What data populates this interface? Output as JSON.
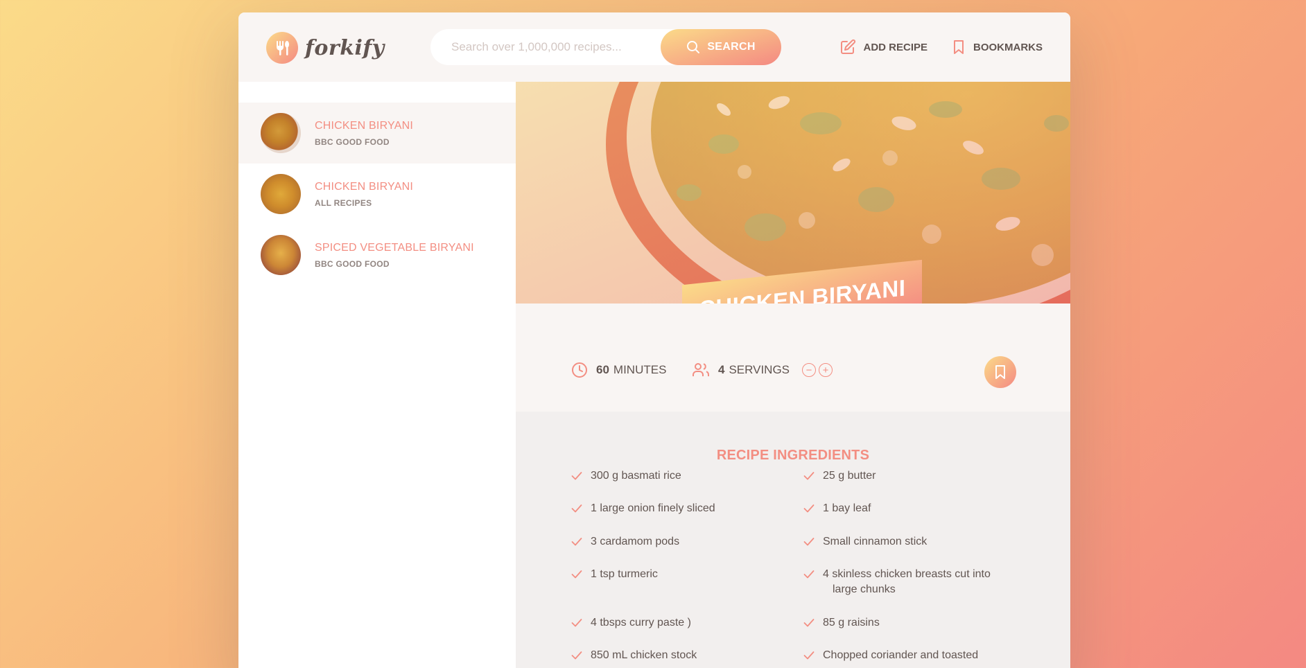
{
  "header": {
    "logo_text": "forkify",
    "search_placeholder": "Search over 1,000,000 recipes...",
    "search_button": "SEARCH",
    "nav": {
      "add_recipe": "ADD RECIPE",
      "bookmarks": "BOOKMARKS"
    }
  },
  "results": [
    {
      "title": "CHICKEN BIRYANI",
      "publisher": "BBC GOOD FOOD",
      "active": true
    },
    {
      "title": "CHICKEN BIRYANI",
      "publisher": "ALL RECIPES",
      "active": false
    },
    {
      "title": "SPICED VEGETABLE BIRYANI",
      "publisher": "BBC GOOD FOOD",
      "active": false
    }
  ],
  "recipe": {
    "title": "CHICKEN BIRYANI",
    "minutes_value": "60",
    "minutes_label": "MINUTES",
    "servings_value": "4",
    "servings_label": "SERVINGS",
    "decrease_symbol": "−",
    "increase_symbol": "+",
    "ingredients_heading": "RECIPE INGREDIENTS",
    "ingredients": [
      {
        "line1": "300 g basmati rice",
        "line2": ""
      },
      {
        "line1": "25 g butter",
        "line2": ""
      },
      {
        "line1": "1 large onion finely sliced",
        "line2": ""
      },
      {
        "line1": "1 bay leaf",
        "line2": ""
      },
      {
        "line1": "3 cardamom pods",
        "line2": ""
      },
      {
        "line1": " Small cinnamon stick",
        "line2": ""
      },
      {
        "line1": "1 tsp turmeric",
        "line2": ""
      },
      {
        "line1": "4 skinless chicken breasts cut into",
        "line2": "large chunks"
      },
      {
        "line1": "4 tbsps curry paste )",
        "line2": ""
      },
      {
        "line1": "85 g raisins",
        "line2": ""
      },
      {
        "line1": "850 mL chicken stock",
        "line2": ""
      },
      {
        "line1": " Chopped coriander and toasted",
        "line2": ""
      }
    ]
  },
  "colors": {
    "accent": "#f38e82",
    "grad_start": "#fbdb89",
    "grad_end": "#f48982",
    "text": "#615551",
    "panel": "#f9f5f3"
  }
}
